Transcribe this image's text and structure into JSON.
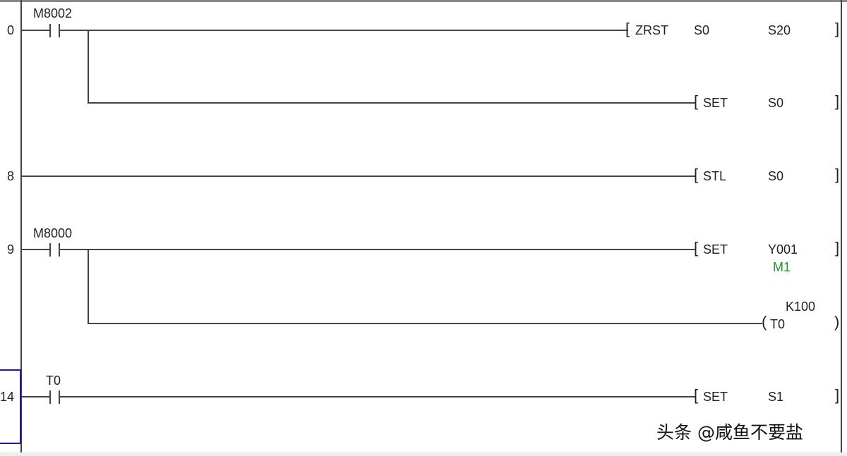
{
  "rungs": [
    {
      "step": "0",
      "contact": "M8002",
      "instructions": [
        {
          "op": "ZRST",
          "args": [
            "S0",
            "S20"
          ]
        },
        {
          "op": "SET",
          "args": [
            "S0"
          ]
        }
      ]
    },
    {
      "step": "8",
      "instructions": [
        {
          "op": "STL",
          "args": [
            "S0"
          ]
        }
      ]
    },
    {
      "step": "9",
      "contact": "M8000",
      "instructions": [
        {
          "op": "SET",
          "args": [
            "Y001"
          ],
          "comment": "M1"
        },
        {
          "coil": "T0",
          "setting": "K100"
        }
      ]
    },
    {
      "step": "14",
      "contact": "T0",
      "selected": true,
      "instructions": [
        {
          "op": "SET",
          "args": [
            "S1"
          ]
        }
      ]
    }
  ],
  "colors": {
    "wire": "#444444",
    "comment": "#1a9a2a",
    "cursor": "#1a1aa0"
  },
  "watermark": "头条 @咸鱼不要盐"
}
